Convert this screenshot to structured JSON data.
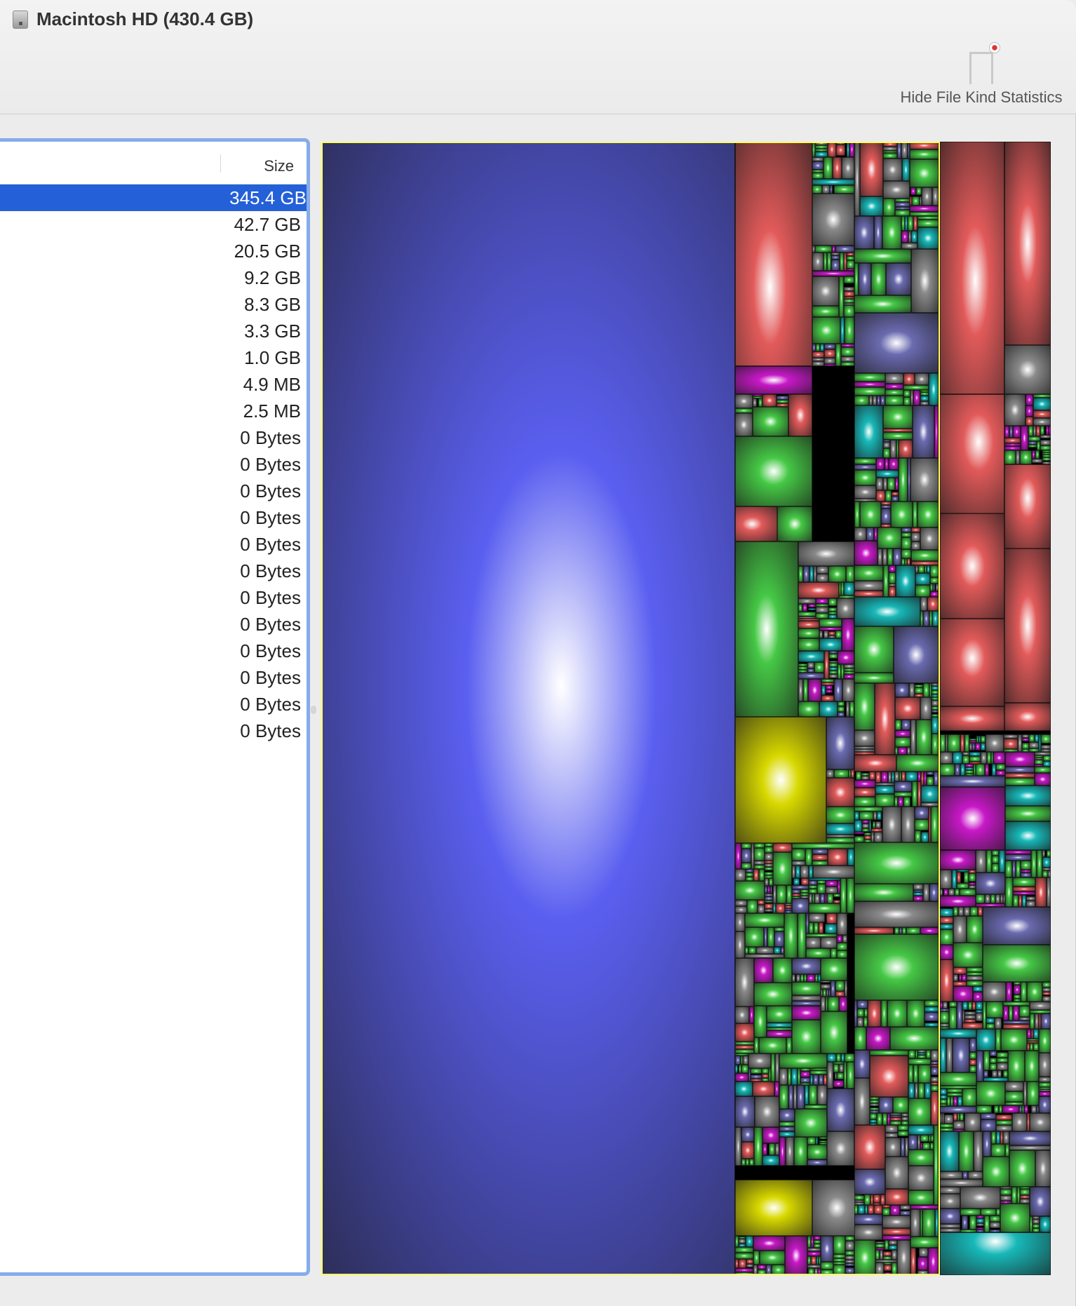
{
  "window": {
    "title": "Macintosh HD (430.4 GB)"
  },
  "toolbar": {
    "hide_stats_label": "Hide File Kind Statistics"
  },
  "list": {
    "size_header": "Size",
    "sizes": [
      "345.4 GB",
      "42.7 GB",
      "20.5 GB",
      "9.2 GB",
      "8.3 GB",
      "3.3 GB",
      "1.0 GB",
      "4.9 MB",
      "2.5 MB",
      "0 Bytes",
      "0 Bytes",
      "0 Bytes",
      "0 Bytes",
      "0 Bytes",
      "0 Bytes",
      "0 Bytes",
      "0 Bytes",
      "0 Bytes",
      "0 Bytes",
      "0 Bytes",
      "0 Bytes"
    ],
    "selected_index": 0
  },
  "treemap_colors": {
    "blue": "#5a5ff0",
    "red": "#e25a5a",
    "green": "#45c845",
    "teal": "#18b8b8",
    "magenta": "#c818c8",
    "yellow": "#d8d800",
    "gray": "#8a8a8a",
    "slate": "#6a6ab0",
    "selection": "#2460d8",
    "highlight": "#ffff5a"
  }
}
